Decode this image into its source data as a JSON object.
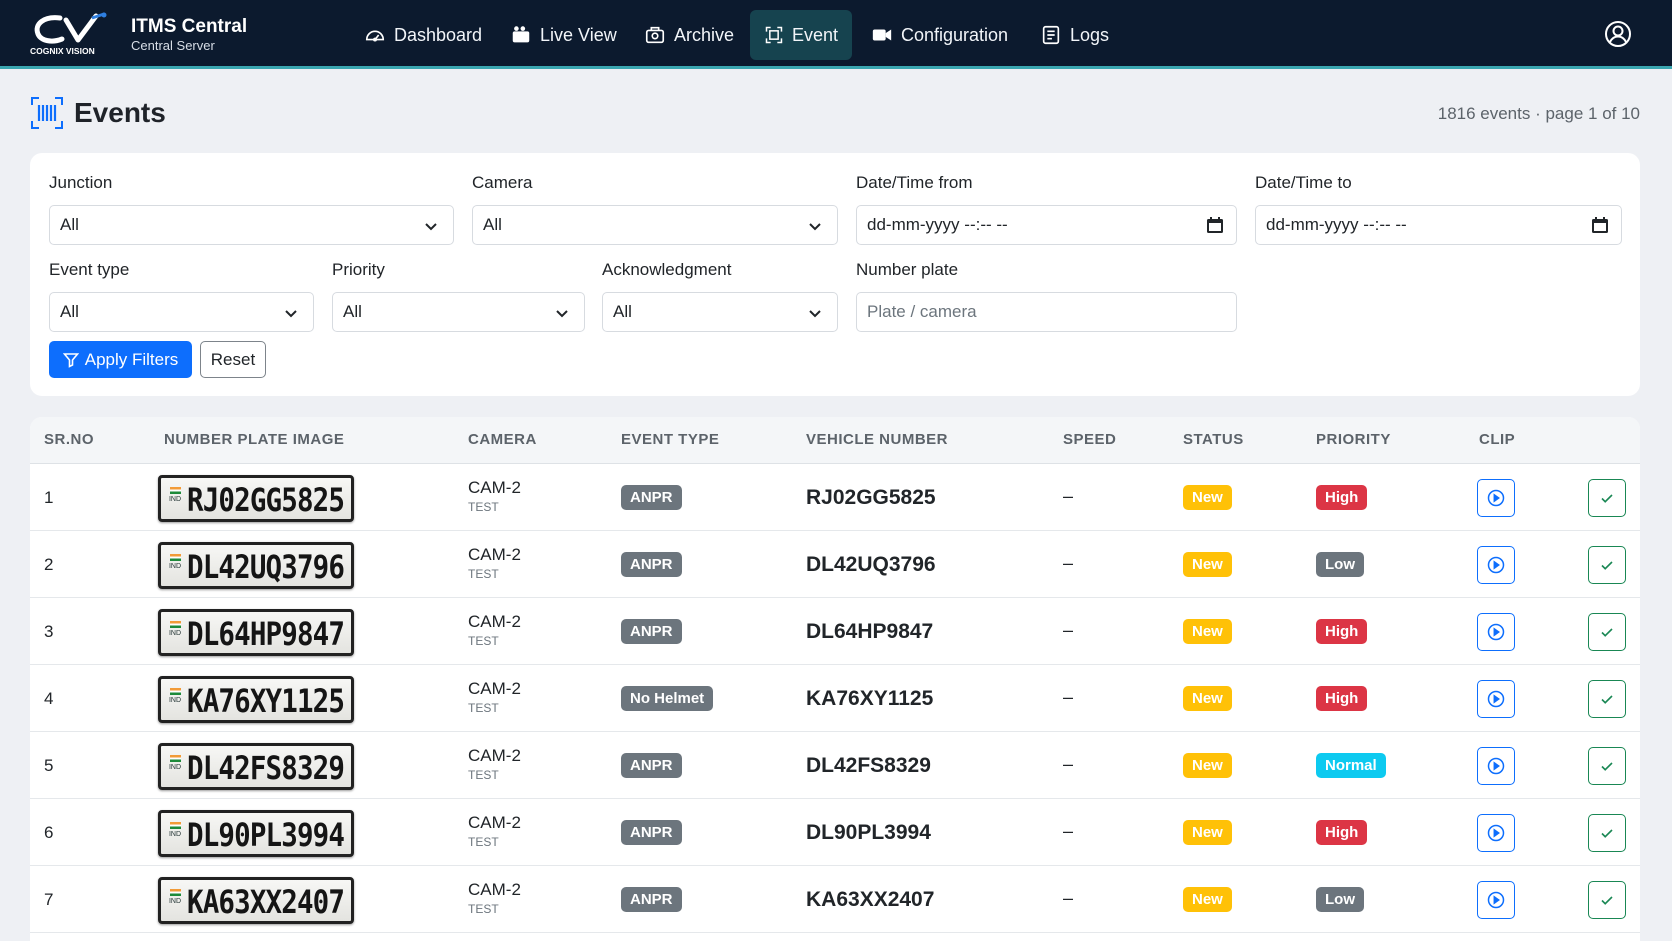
{
  "brand": {
    "title": "ITMS Central",
    "subtitle": "Central Server",
    "logo_text": "COGNIX VISION"
  },
  "nav": [
    {
      "label": "Dashboard",
      "icon": "gauge-icon"
    },
    {
      "label": "Live View",
      "icon": "camera-icon"
    },
    {
      "label": "Archive",
      "icon": "archive-icon"
    },
    {
      "label": "Event",
      "icon": "scan-icon",
      "active": true
    },
    {
      "label": "Configuration",
      "icon": "video-camera-icon"
    },
    {
      "label": "Logs",
      "icon": "list-icon"
    }
  ],
  "header": {
    "title": "Events",
    "meta": "1816 events · page 1 of 10"
  },
  "filters": {
    "junction": {
      "label": "Junction",
      "value": "All"
    },
    "camera": {
      "label": "Camera",
      "value": "All"
    },
    "date_from": {
      "label": "Date/Time from",
      "value": "dd-mm-yyyy --:-- --"
    },
    "date_to": {
      "label": "Date/Time to",
      "value": "dd-mm-yyyy --:-- --"
    },
    "event_type": {
      "label": "Event type",
      "value": "All"
    },
    "priority": {
      "label": "Priority",
      "value": "All"
    },
    "ack": {
      "label": "Acknowledgment",
      "value": "All"
    },
    "plate": {
      "label": "Number plate",
      "placeholder": "Plate / camera"
    },
    "apply_label": "Apply Filters",
    "reset_label": "Reset"
  },
  "table": {
    "columns": [
      "SR.NO",
      "NUMBER PLATE IMAGE",
      "CAMERA",
      "EVENT TYPE",
      "VEHICLE NUMBER",
      "SPEED",
      "STATUS",
      "PRIORITY",
      "CLIP"
    ],
    "rows": [
      {
        "sr": "1",
        "plate_region": "IND",
        "plate": "RJ02GG5825",
        "camera": "CAM-2",
        "camera_sub": "TEST",
        "event": "ANPR",
        "vehicle": "RJ02GG5825",
        "speed": "–",
        "status": "New",
        "priority": "High"
      },
      {
        "sr": "2",
        "plate_region": "IND",
        "plate": "DL42UQ3796",
        "camera": "CAM-2",
        "camera_sub": "TEST",
        "event": "ANPR",
        "vehicle": "DL42UQ3796",
        "speed": "–",
        "status": "New",
        "priority": "Low"
      },
      {
        "sr": "3",
        "plate_region": "IND",
        "plate": "DL64HP9847",
        "camera": "CAM-2",
        "camera_sub": "TEST",
        "event": "ANPR",
        "vehicle": "DL64HP9847",
        "speed": "–",
        "status": "New",
        "priority": "High"
      },
      {
        "sr": "4",
        "plate_region": "IND",
        "plate": "KA76XY1125",
        "camera": "CAM-2",
        "camera_sub": "TEST",
        "event": "No Helmet",
        "vehicle": "KA76XY1125",
        "speed": "–",
        "status": "New",
        "priority": "High"
      },
      {
        "sr": "5",
        "plate_region": "IND",
        "plate": "DL42FS8329",
        "camera": "CAM-2",
        "camera_sub": "TEST",
        "event": "ANPR",
        "vehicle": "DL42FS8329",
        "speed": "–",
        "status": "New",
        "priority": "Normal"
      },
      {
        "sr": "6",
        "plate_region": "IND",
        "plate": "DL90PL3994",
        "camera": "CAM-2",
        "camera_sub": "TEST",
        "event": "ANPR",
        "vehicle": "DL90PL3994",
        "speed": "–",
        "status": "New",
        "priority": "High"
      },
      {
        "sr": "7",
        "plate_region": "IND",
        "plate": "KA63XX2407",
        "camera": "CAM-2",
        "camera_sub": "TEST",
        "event": "ANPR",
        "vehicle": "KA63XX2407",
        "speed": "–",
        "status": "New",
        "priority": "Low"
      }
    ]
  },
  "colors": {
    "nav_bg": "#0c1a2e",
    "accent": "#0d6efd",
    "status_new": "#ffc107",
    "priority_high": "#dc3545",
    "priority_low": "#6c757d",
    "priority_normal": "#0dcaf0"
  }
}
